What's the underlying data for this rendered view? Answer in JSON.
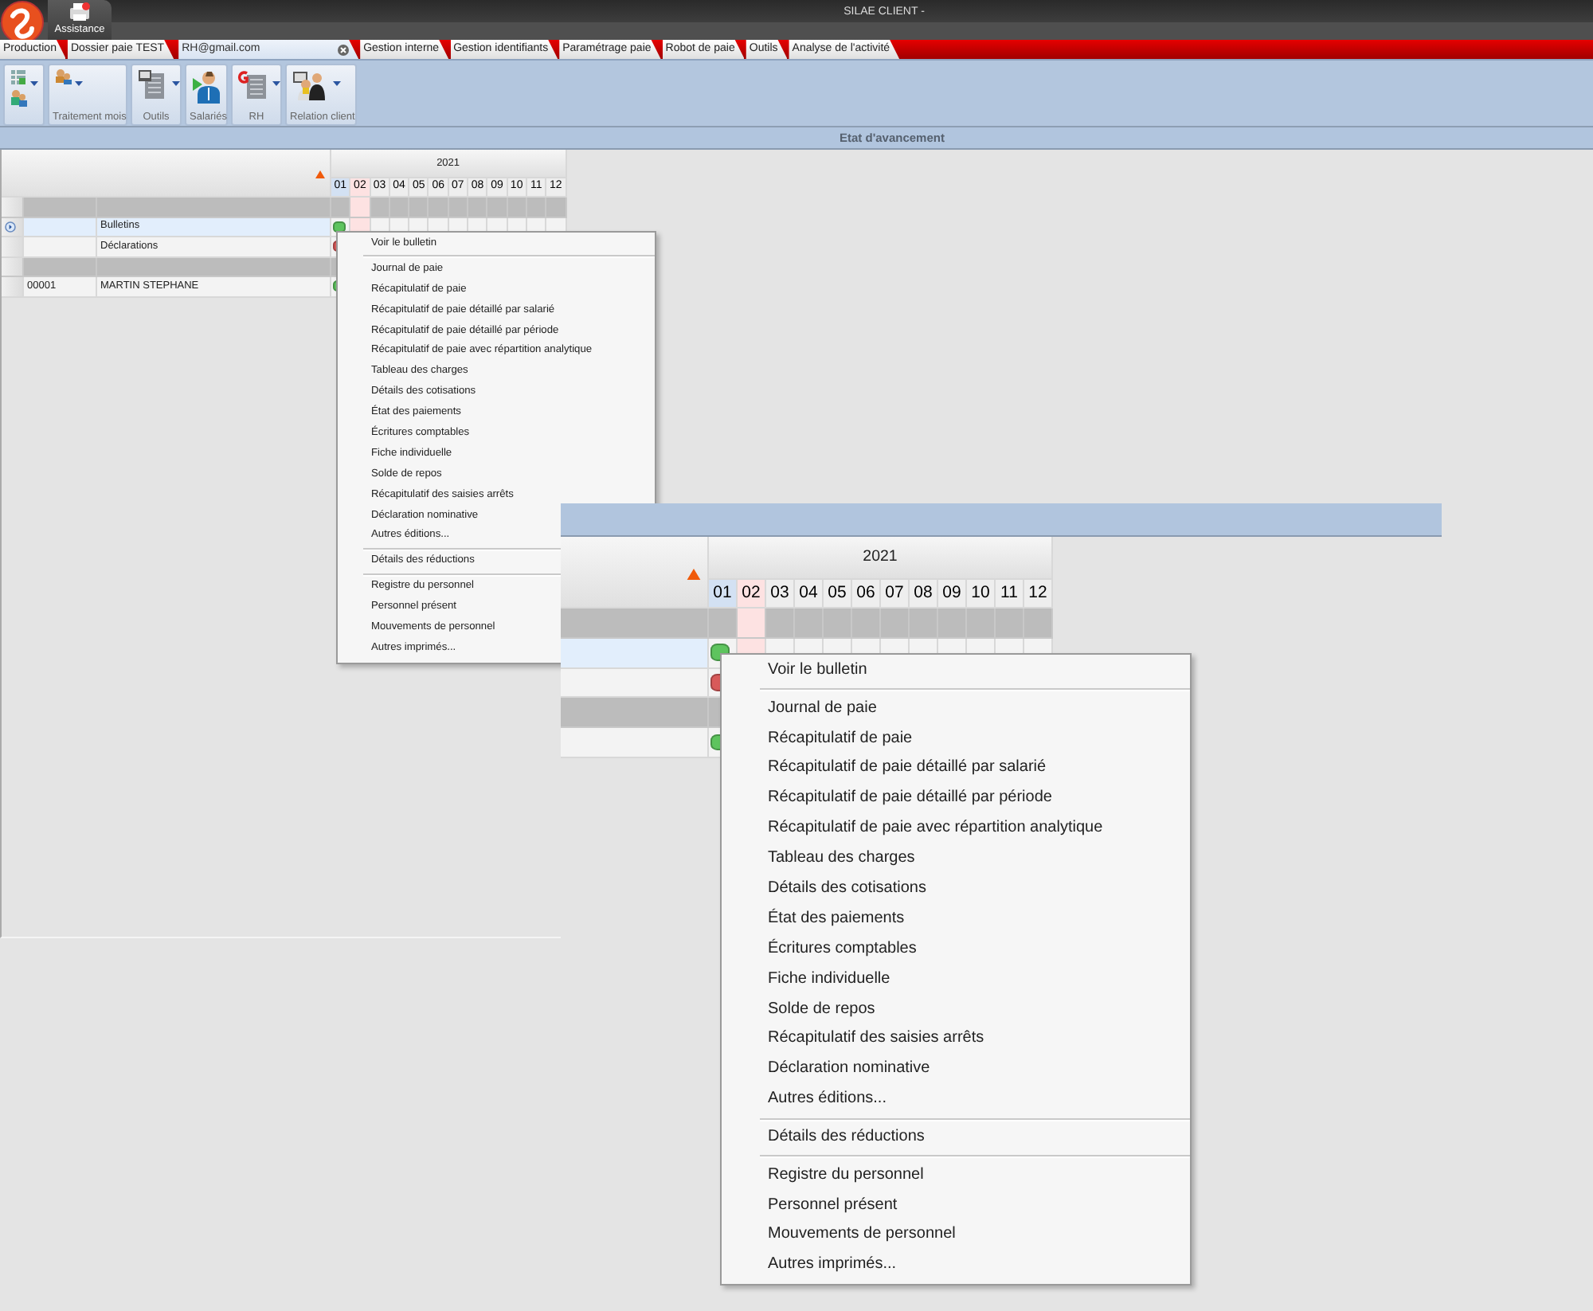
{
  "window": {
    "title": "SILAE CLIENT -"
  },
  "app_buttons": [
    {
      "label": "Assistance",
      "selected": true
    }
  ],
  "tabs": [
    {
      "label": "Production",
      "selected": false,
      "closable": false
    },
    {
      "label": "Dossier paie TEST",
      "selected": false,
      "closable": false
    },
    {
      "label": "RH@gmail.com",
      "selected": true,
      "closable": true
    },
    {
      "label": "Gestion interne",
      "selected": false,
      "closable": false
    },
    {
      "label": "Gestion identifiants",
      "selected": false,
      "closable": false
    },
    {
      "label": "Paramétrage paie",
      "selected": false,
      "closable": false
    },
    {
      "label": "Robot de paie",
      "selected": false,
      "closable": false
    },
    {
      "label": "Outils",
      "selected": false,
      "closable": false
    },
    {
      "label": "Analyse de l'activité",
      "selected": false,
      "closable": false
    }
  ],
  "ribbon_groups": [
    {
      "dropdown": true
    },
    {
      "label": "Traitement mois",
      "dropdown": true
    },
    {
      "label": "Outils",
      "dropdown": true
    },
    {
      "label": "Salariés",
      "dropdown": false
    },
    {
      "label": "RH",
      "dropdown": true
    },
    {
      "label": "Relation client",
      "dropdown": true
    }
  ],
  "section_title": "Etat d'avancement",
  "grid": {
    "year": "2021",
    "months": [
      {
        "label": "01",
        "selected": true,
        "current": false
      },
      {
        "label": "02",
        "selected": false,
        "current": true
      },
      {
        "label": "03",
        "selected": false,
        "current": false
      },
      {
        "label": "04",
        "selected": false,
        "current": false
      },
      {
        "label": "05",
        "selected": false,
        "current": false
      },
      {
        "label": "06",
        "selected": false,
        "current": false
      },
      {
        "label": "07",
        "selected": false,
        "current": false
      },
      {
        "label": "08",
        "selected": false,
        "current": false
      },
      {
        "label": "09",
        "selected": false,
        "current": false
      },
      {
        "label": "10",
        "selected": false,
        "current": false
      },
      {
        "label": "11",
        "selected": false,
        "current": false
      },
      {
        "label": "12",
        "selected": false,
        "current": false
      }
    ],
    "rows": [
      {
        "kind": "group"
      },
      {
        "kind": "item",
        "name": "Bulletins",
        "selected": true,
        "color": "#5ec45e"
      },
      {
        "kind": "item",
        "name": "Déclarations",
        "selected": false,
        "color": "#d85a5a"
      },
      {
        "kind": "group"
      },
      {
        "kind": "item",
        "code": "00001",
        "name": "MARTIN STEPHANE",
        "selected": false,
        "color": "#5ec45e"
      }
    ]
  },
  "context_menu": {
    "items": [
      {
        "kind": "item",
        "label": "Voir le bulletin"
      },
      {
        "kind": "separator"
      },
      {
        "kind": "item",
        "label": "Journal de paie"
      },
      {
        "kind": "item",
        "label": "Récapitulatif de paie"
      },
      {
        "kind": "item",
        "label": "Récapitulatif de paie détaillé par salarié"
      },
      {
        "kind": "item",
        "label": "Récapitulatif de paie détaillé par période"
      },
      {
        "kind": "item",
        "label": "Récapitulatif de paie avec répartition analytique"
      },
      {
        "kind": "item",
        "label": "Tableau des charges"
      },
      {
        "kind": "item",
        "label": "Détails des cotisations"
      },
      {
        "kind": "item",
        "label": "État des paiements"
      },
      {
        "kind": "item",
        "label": "Écritures comptables"
      },
      {
        "kind": "item",
        "label": "Fiche individuelle"
      },
      {
        "kind": "item",
        "label": "Solde de repos"
      },
      {
        "kind": "item",
        "label": "Récapitulatif des saisies arrêts"
      },
      {
        "kind": "item",
        "label": "Déclaration nominative"
      },
      {
        "kind": "item",
        "label": "Autres éditions..."
      },
      {
        "kind": "separator"
      },
      {
        "kind": "item",
        "label": "Détails des réductions"
      },
      {
        "kind": "separator"
      },
      {
        "kind": "item",
        "label": "Registre du personnel"
      },
      {
        "kind": "item",
        "label": "Personnel présent"
      },
      {
        "kind": "item",
        "label": "Mouvements de personnel"
      },
      {
        "kind": "item",
        "label": "Autres imprimés..."
      }
    ]
  },
  "zoom_inset": {
    "grid": {
      "year": "2021",
      "months": [
        {
          "label": "01",
          "selected": true,
          "current": false
        },
        {
          "label": "02",
          "selected": false,
          "current": true
        },
        {
          "label": "03",
          "selected": false,
          "current": false
        },
        {
          "label": "04",
          "selected": false,
          "current": false
        },
        {
          "label": "05",
          "selected": false,
          "current": false
        },
        {
          "label": "06",
          "selected": false,
          "current": false
        },
        {
          "label": "07",
          "selected": false,
          "current": false
        },
        {
          "label": "08",
          "selected": false,
          "current": false
        },
        {
          "label": "09",
          "selected": false,
          "current": false
        },
        {
          "label": "10",
          "selected": false,
          "current": false
        },
        {
          "label": "11",
          "selected": false,
          "current": false
        },
        {
          "label": "12",
          "selected": false,
          "current": false
        }
      ],
      "rows": [
        {
          "kind": "group"
        },
        {
          "kind": "item",
          "selected": true,
          "color": "#5ec45e"
        },
        {
          "kind": "item",
          "selected": false,
          "color": "#d85a5a"
        },
        {
          "kind": "group"
        },
        {
          "kind": "item",
          "selected": false,
          "color": "#5ec45e"
        }
      ]
    },
    "context_menu": {
      "items": [
        {
          "kind": "item",
          "label": "Voir le bulletin"
        },
        {
          "kind": "separator"
        },
        {
          "kind": "item",
          "label": "Journal de paie"
        },
        {
          "kind": "item",
          "label": "Récapitulatif de paie"
        },
        {
          "kind": "item",
          "label": "Récapitulatif de paie détaillé par salarié"
        },
        {
          "kind": "item",
          "label": "Récapitulatif de paie détaillé par période"
        },
        {
          "kind": "item",
          "label": "Récapitulatif de paie avec répartition analytique"
        },
        {
          "kind": "item",
          "label": "Tableau des charges"
        },
        {
          "kind": "item",
          "label": "Détails des cotisations"
        },
        {
          "kind": "item",
          "label": "État des paiements"
        },
        {
          "kind": "item",
          "label": "Écritures comptables"
        },
        {
          "kind": "item",
          "label": "Fiche individuelle"
        },
        {
          "kind": "item",
          "label": "Solde de repos"
        },
        {
          "kind": "item",
          "label": "Récapitulatif des saisies arrêts"
        },
        {
          "kind": "item",
          "label": "Déclaration nominative"
        },
        {
          "kind": "item",
          "label": "Autres éditions..."
        },
        {
          "kind": "separator"
        },
        {
          "kind": "item",
          "label": "Détails des réductions"
        },
        {
          "kind": "separator"
        },
        {
          "kind": "item",
          "label": "Registre du personnel"
        },
        {
          "kind": "item",
          "label": "Personnel présent"
        },
        {
          "kind": "item",
          "label": "Mouvements de personnel"
        },
        {
          "kind": "item",
          "label": "Autres imprimés..."
        }
      ]
    }
  }
}
